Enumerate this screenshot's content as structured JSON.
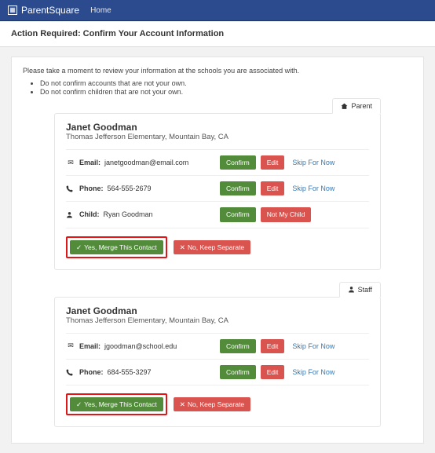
{
  "topbar": {
    "brand": "ParentSquare",
    "home": "Home"
  },
  "header": "Action Required: Confirm Your Account Information",
  "intro": "Please take a moment to review your information at the schools you are associated with.",
  "bullets": [
    "Do not confirm accounts that are not your own.",
    "Do not confirm children that are not your own."
  ],
  "labels": {
    "email": "Email:",
    "phone": "Phone:",
    "child": "Child:",
    "confirm": "Confirm",
    "edit": "Edit",
    "skip": "Skip For Now",
    "not_my_child": "Not My Child",
    "merge": "Yes, Merge This Contact",
    "separate": "No, Keep Separate",
    "parent_tab": "Parent",
    "staff_tab": "Staff"
  },
  "cards": [
    {
      "role": "Parent",
      "name": "Janet Goodman",
      "school": "Thomas Jefferson Elementary, Mountain Bay, CA",
      "email": "janetgoodman@email.com",
      "phone": "564-555-2679",
      "child": "Ryan Goodman"
    },
    {
      "role": "Staff",
      "name": "Janet Goodman",
      "school": "Thomas Jefferson Elementary, Mountain Bay, CA",
      "email": "jgoodman@school.edu",
      "phone": "684-555-3297"
    }
  ]
}
